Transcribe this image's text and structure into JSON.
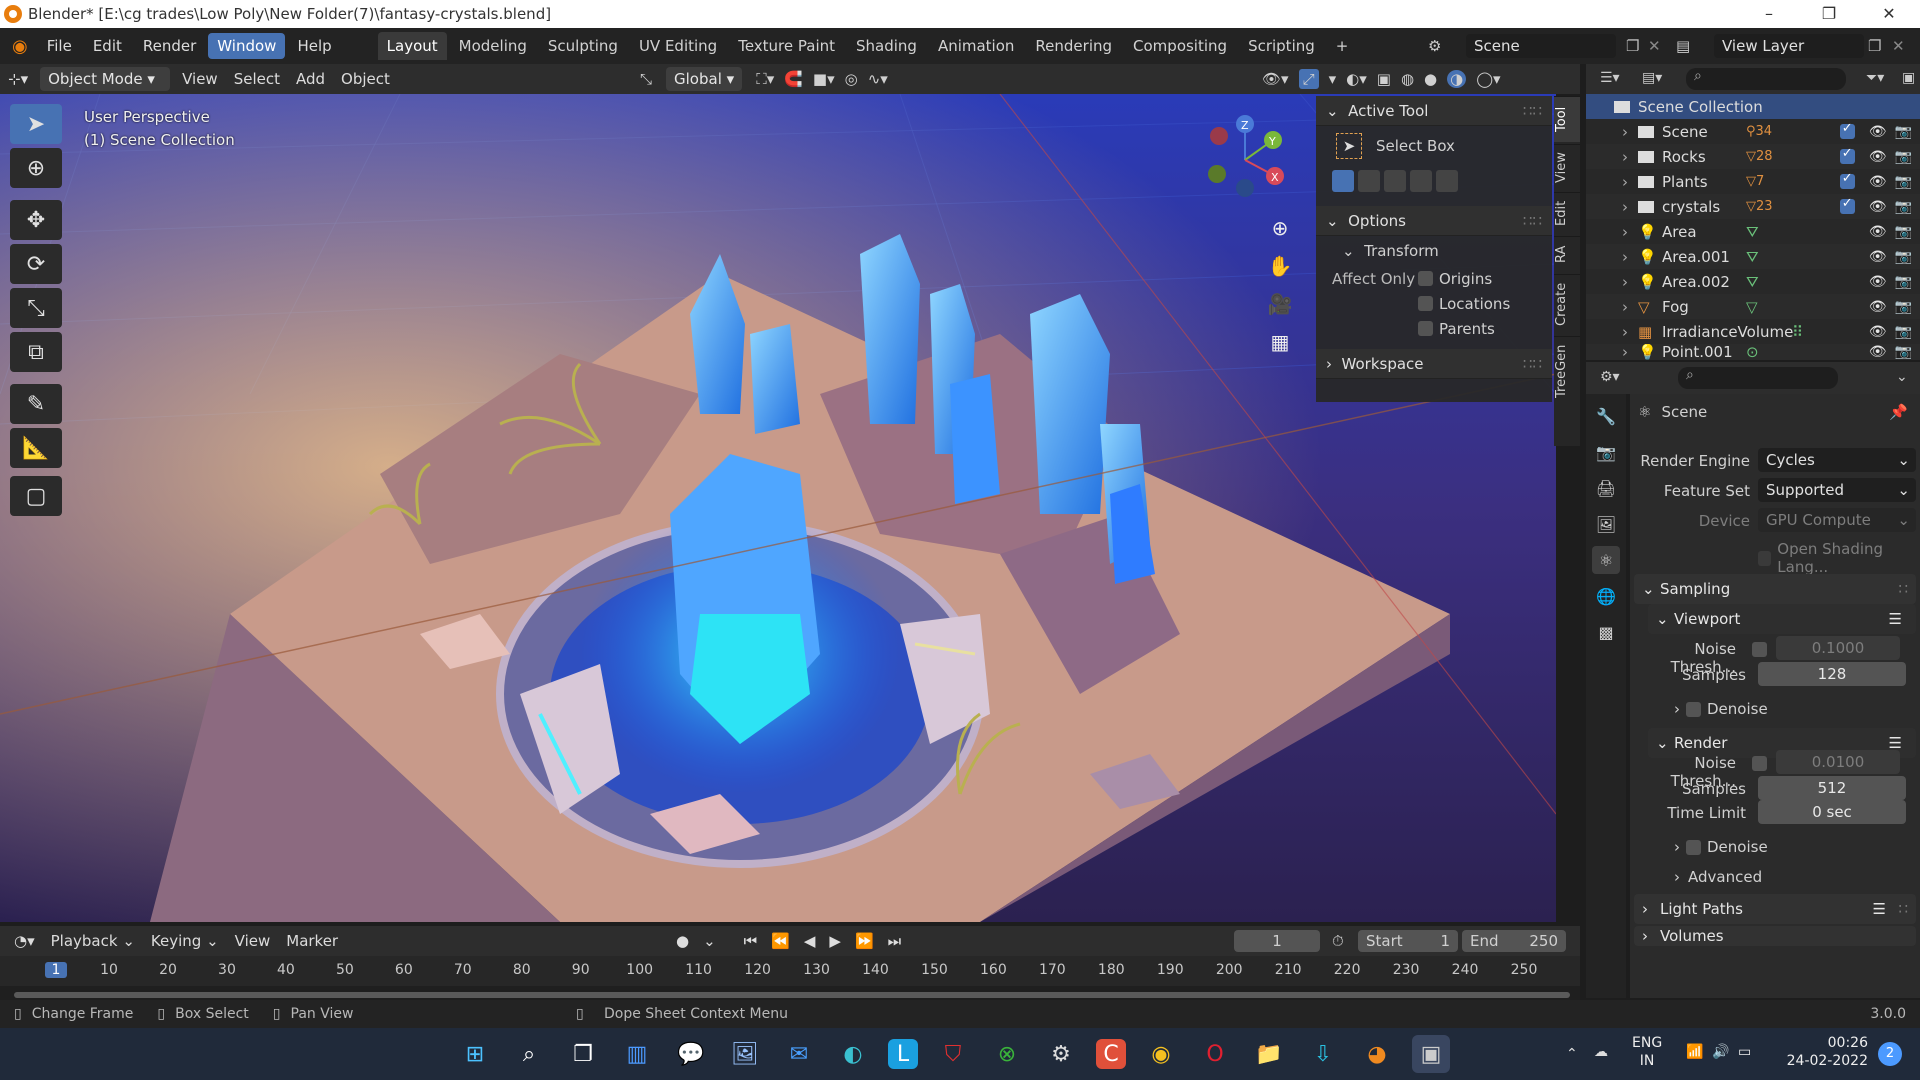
{
  "window": {
    "title": "Blender* [E:\\cg trades\\Low Poly\\New Folder(7)\\fantasy-crystals.blend]",
    "controls": [
      "–",
      "❐",
      "✕"
    ]
  },
  "menubar": {
    "items": [
      "File",
      "Edit",
      "Render",
      "Window",
      "Help"
    ],
    "active": "Window",
    "workspaces": [
      "Layout",
      "Modeling",
      "Sculpting",
      "UV Editing",
      "Texture Paint",
      "Shading",
      "Animation",
      "Rendering",
      "Compositing",
      "Scripting",
      "+"
    ],
    "active_workspace": "Layout",
    "scene_label": "Scene",
    "view_layer_label": "View Layer"
  },
  "viewport_header": {
    "mode": "Object Mode",
    "menus": [
      "View",
      "Select",
      "Add",
      "Object"
    ],
    "orientation": "Global"
  },
  "viewport": {
    "perspective": "User Perspective",
    "collection": "(1) Scene Collection",
    "gizmo_axes": [
      "Z",
      "Y",
      "X"
    ]
  },
  "npanel": {
    "active_tool_header": "Active Tool",
    "tool_name": "Select Box",
    "options_header": "Options",
    "transform_header": "Transform",
    "affect_only_label": "Affect Only",
    "affect_options": [
      "Origins",
      "Locations",
      "Parents"
    ],
    "workspace_header": "Workspace",
    "tabs": [
      "Tool",
      "View",
      "Edit",
      "RA",
      "Create",
      "TreeGen"
    ]
  },
  "outliner": {
    "root": "Scene Collection",
    "rows": [
      {
        "name": "Scene",
        "badge": "34",
        "type": "collection"
      },
      {
        "name": "Rocks",
        "badge": "28",
        "type": "collection"
      },
      {
        "name": "Plants",
        "badge": "7",
        "type": "collection"
      },
      {
        "name": "crystals",
        "badge": "23",
        "type": "collection"
      },
      {
        "name": "Area",
        "badge": "",
        "type": "light"
      },
      {
        "name": "Area.001",
        "badge": "",
        "type": "light"
      },
      {
        "name": "Area.002",
        "badge": "",
        "type": "light"
      },
      {
        "name": "Fog",
        "badge": "",
        "type": "mesh"
      },
      {
        "name": "IrradianceVolume",
        "badge": "",
        "type": "probe"
      },
      {
        "name": "Point.001",
        "badge": "",
        "type": "light"
      }
    ]
  },
  "properties": {
    "context": "Scene",
    "render_engine_label": "Render Engine",
    "render_engine": "Cycles",
    "feature_set_label": "Feature Set",
    "feature_set": "Supported",
    "device_label": "Device",
    "device": "GPU Compute",
    "osl_label": "Open Shading Lang...",
    "sampling": "Sampling",
    "viewport": "Viewport",
    "noise_label": "Noise Thresh...",
    "viewport_noise": "0.1000",
    "samples_label": "Samples",
    "viewport_samples": "128",
    "denoise": "Denoise",
    "render": "Render",
    "render_noise": "0.0100",
    "render_samples": "512",
    "time_limit_label": "Time Limit",
    "time_limit": "0 sec",
    "advanced": "Advanced",
    "light_paths": "Light Paths",
    "volumes": "Volumes"
  },
  "timeline": {
    "menus": [
      "Playback",
      "Keying",
      "View",
      "Marker"
    ],
    "current_frame": "1",
    "start_label": "Start",
    "start": "1",
    "end_label": "End",
    "end": "250",
    "ticks": [
      "1",
      "10",
      "20",
      "30",
      "40",
      "50",
      "60",
      "70",
      "80",
      "90",
      "100",
      "110",
      "120",
      "130",
      "140",
      "150",
      "160",
      "170",
      "180",
      "190",
      "200",
      "210",
      "220",
      "230",
      "240",
      "250"
    ]
  },
  "statusbar": {
    "hints": [
      "Change Frame",
      "Box Select",
      "Pan View",
      "Dope Sheet Context Menu"
    ],
    "version": "3.0.0"
  },
  "taskbar": {
    "lang": "ENG",
    "region": "IN",
    "time": "00:26",
    "date": "24-02-2022",
    "notification_count": "2"
  }
}
